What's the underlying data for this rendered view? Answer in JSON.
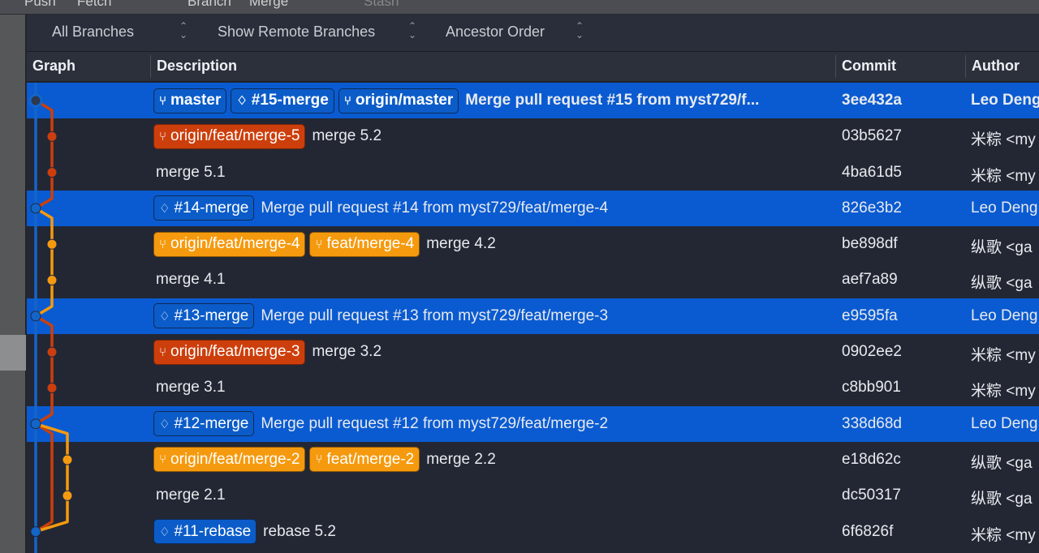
{
  "topbar": {
    "items": [
      "Push",
      "Fetch",
      "Branch",
      "Merge",
      "Stash"
    ]
  },
  "toolbar": {
    "branches": "All Branches",
    "remote": "Show Remote Branches",
    "order": "Ancestor Order"
  },
  "header": {
    "graph": "Graph",
    "description": "Description",
    "commit": "Commit",
    "author": "Author"
  },
  "colors": {
    "highlight": "#0a5bd1",
    "blue": "#0b5cc9",
    "red": "#cc3f0c",
    "orange": "#f59a0e",
    "background": "#232734"
  },
  "rows": [
    {
      "hl": true,
      "bold": true,
      "badges": [
        {
          "t": "branch",
          "c": "blue",
          "l": "master"
        },
        {
          "t": "tag",
          "c": "blue",
          "l": "#15-merge"
        },
        {
          "t": "branch",
          "c": "blue",
          "l": "origin/master"
        }
      ],
      "msg": "Merge pull request #15 from myst729/f...",
      "commit": "3ee432a",
      "author": "Leo Deng"
    },
    {
      "badges": [
        {
          "t": "branch",
          "c": "red",
          "l": "origin/feat/merge-5"
        }
      ],
      "msg": "merge 5.2",
      "commit": "03b5627",
      "author": "米粽 <my"
    },
    {
      "badges": [],
      "msg": "merge 5.1",
      "commit": "4ba61d5",
      "author": "米粽 <my"
    },
    {
      "hl": true,
      "badges": [
        {
          "t": "tag",
          "c": "blue",
          "l": "#14-merge"
        }
      ],
      "msg": "Merge pull request #14 from myst729/feat/merge-4",
      "commit": "826e3b2",
      "author": "Leo Deng"
    },
    {
      "badges": [
        {
          "t": "branch",
          "c": "orange",
          "l": "origin/feat/merge-4"
        },
        {
          "t": "branch",
          "c": "orange",
          "l": "feat/merge-4"
        }
      ],
      "msg": "merge 4.2",
      "commit": "be898df",
      "author": "纵歌 <ga"
    },
    {
      "badges": [],
      "msg": "merge 4.1",
      "commit": "aef7a89",
      "author": "纵歌 <ga"
    },
    {
      "hl": true,
      "badges": [
        {
          "t": "tag",
          "c": "blue",
          "l": "#13-merge"
        }
      ],
      "msg": "Merge pull request #13 from myst729/feat/merge-3",
      "commit": "e9595fa",
      "author": "Leo Deng"
    },
    {
      "badges": [
        {
          "t": "branch",
          "c": "red",
          "l": "origin/feat/merge-3"
        }
      ],
      "msg": "merge 3.2",
      "commit": "0902ee2",
      "author": "米粽 <my"
    },
    {
      "badges": [],
      "msg": "merge 3.1",
      "commit": "c8bb901",
      "author": "米粽 <my"
    },
    {
      "hl": true,
      "badges": [
        {
          "t": "tag",
          "c": "blue",
          "l": "#12-merge"
        }
      ],
      "msg": "Merge pull request #12 from myst729/feat/merge-2",
      "commit": "338d68d",
      "author": "Leo Deng"
    },
    {
      "badges": [
        {
          "t": "branch",
          "c": "orange",
          "l": "origin/feat/merge-2"
        },
        {
          "t": "branch",
          "c": "orange",
          "l": "feat/merge-2"
        }
      ],
      "msg": "merge 2.2",
      "commit": "e18d62c",
      "author": "纵歌 <ga"
    },
    {
      "badges": [],
      "msg": "merge 2.1",
      "commit": "dc50317",
      "author": "纵歌 <ga"
    },
    {
      "badges": [
        {
          "t": "tag",
          "c": "blue",
          "l": "#11-rebase"
        }
      ],
      "msg": "rebase 5.2",
      "commit": "6f6826f",
      "author": "米粽 <my"
    }
  ]
}
